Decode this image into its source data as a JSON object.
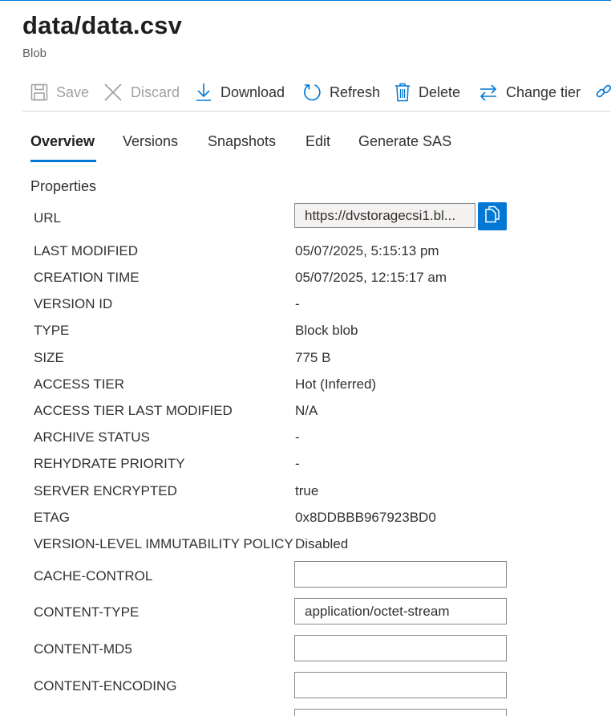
{
  "header": {
    "title": "data/data.csv",
    "subtitle": "Blob"
  },
  "toolbar": {
    "save": "Save",
    "discard": "Discard",
    "download": "Download",
    "refresh": "Refresh",
    "delete": "Delete",
    "change_tier": "Change tier"
  },
  "tabs": [
    "Overview",
    "Versions",
    "Snapshots",
    "Edit",
    "Generate SAS"
  ],
  "active_tab": "Overview",
  "properties": {
    "section_title": "Properties",
    "url_label": "URL",
    "url_value": "https://dvstoragecsi1.bl...",
    "rows": [
      {
        "label": "LAST MODIFIED",
        "value": "05/07/2025, 5:15:13 pm"
      },
      {
        "label": "CREATION TIME",
        "value": "05/07/2025, 12:15:17 am"
      },
      {
        "label": "VERSION ID",
        "value": "-"
      },
      {
        "label": "TYPE",
        "value": "Block blob"
      },
      {
        "label": "SIZE",
        "value": "775 B"
      },
      {
        "label": "ACCESS TIER",
        "value": "Hot (Inferred)"
      },
      {
        "label": "ACCESS TIER LAST MODIFIED",
        "value": "N/A"
      },
      {
        "label": "ARCHIVE STATUS",
        "value": "-"
      },
      {
        "label": "REHYDRATE PRIORITY",
        "value": "-"
      },
      {
        "label": "SERVER ENCRYPTED",
        "value": "true"
      },
      {
        "label": "ETAG",
        "value": "0x8DDBBB967923BD0"
      },
      {
        "label": "VERSION-LEVEL IMMUTABILITY POLICY",
        "value": "Disabled"
      }
    ],
    "fields": [
      {
        "label": "CACHE-CONTROL",
        "value": ""
      },
      {
        "label": "CONTENT-TYPE",
        "value": "application/octet-stream"
      },
      {
        "label": "CONTENT-MD5",
        "value": ""
      },
      {
        "label": "CONTENT-ENCODING",
        "value": ""
      }
    ]
  },
  "colors": {
    "accent": "#0078d4",
    "disabled_text": "#a19f9d"
  }
}
